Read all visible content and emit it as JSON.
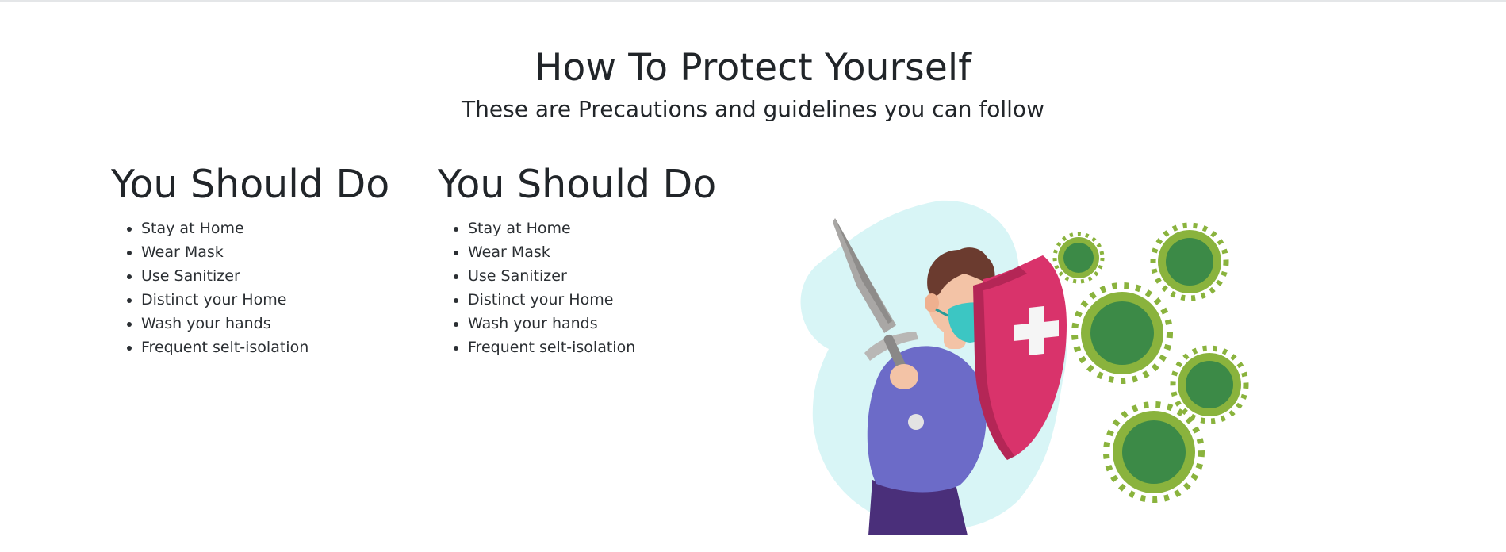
{
  "header": {
    "title": "How To Protect Yourself",
    "subtitle": "These are Precautions and guidelines you can follow"
  },
  "columns": [
    {
      "heading": "You Should Do",
      "items": [
        "Stay at Home",
        "Wear Mask",
        "Use Sanitizer",
        "Distinct your Home",
        "Wash your hands",
        "Frequent selt-isolation"
      ]
    },
    {
      "heading": "You Should Do",
      "items": [
        "Stay at Home",
        "Wear Mask",
        "Use Sanitizer",
        "Distinct your Home",
        "Wash your hands",
        "Frequent selt-isolation"
      ]
    }
  ],
  "illustration": {
    "icon": "man-with-sword-and-shield-vs-virus-illustration",
    "colors": {
      "blob": "#d8f5f6",
      "shirt": "#6c6bc8",
      "shield": "#d9336b",
      "mask": "#3cc6c3",
      "virus": "#8ab33d",
      "virus_core": "#3c8a47",
      "sword": "#9c9a98"
    }
  }
}
